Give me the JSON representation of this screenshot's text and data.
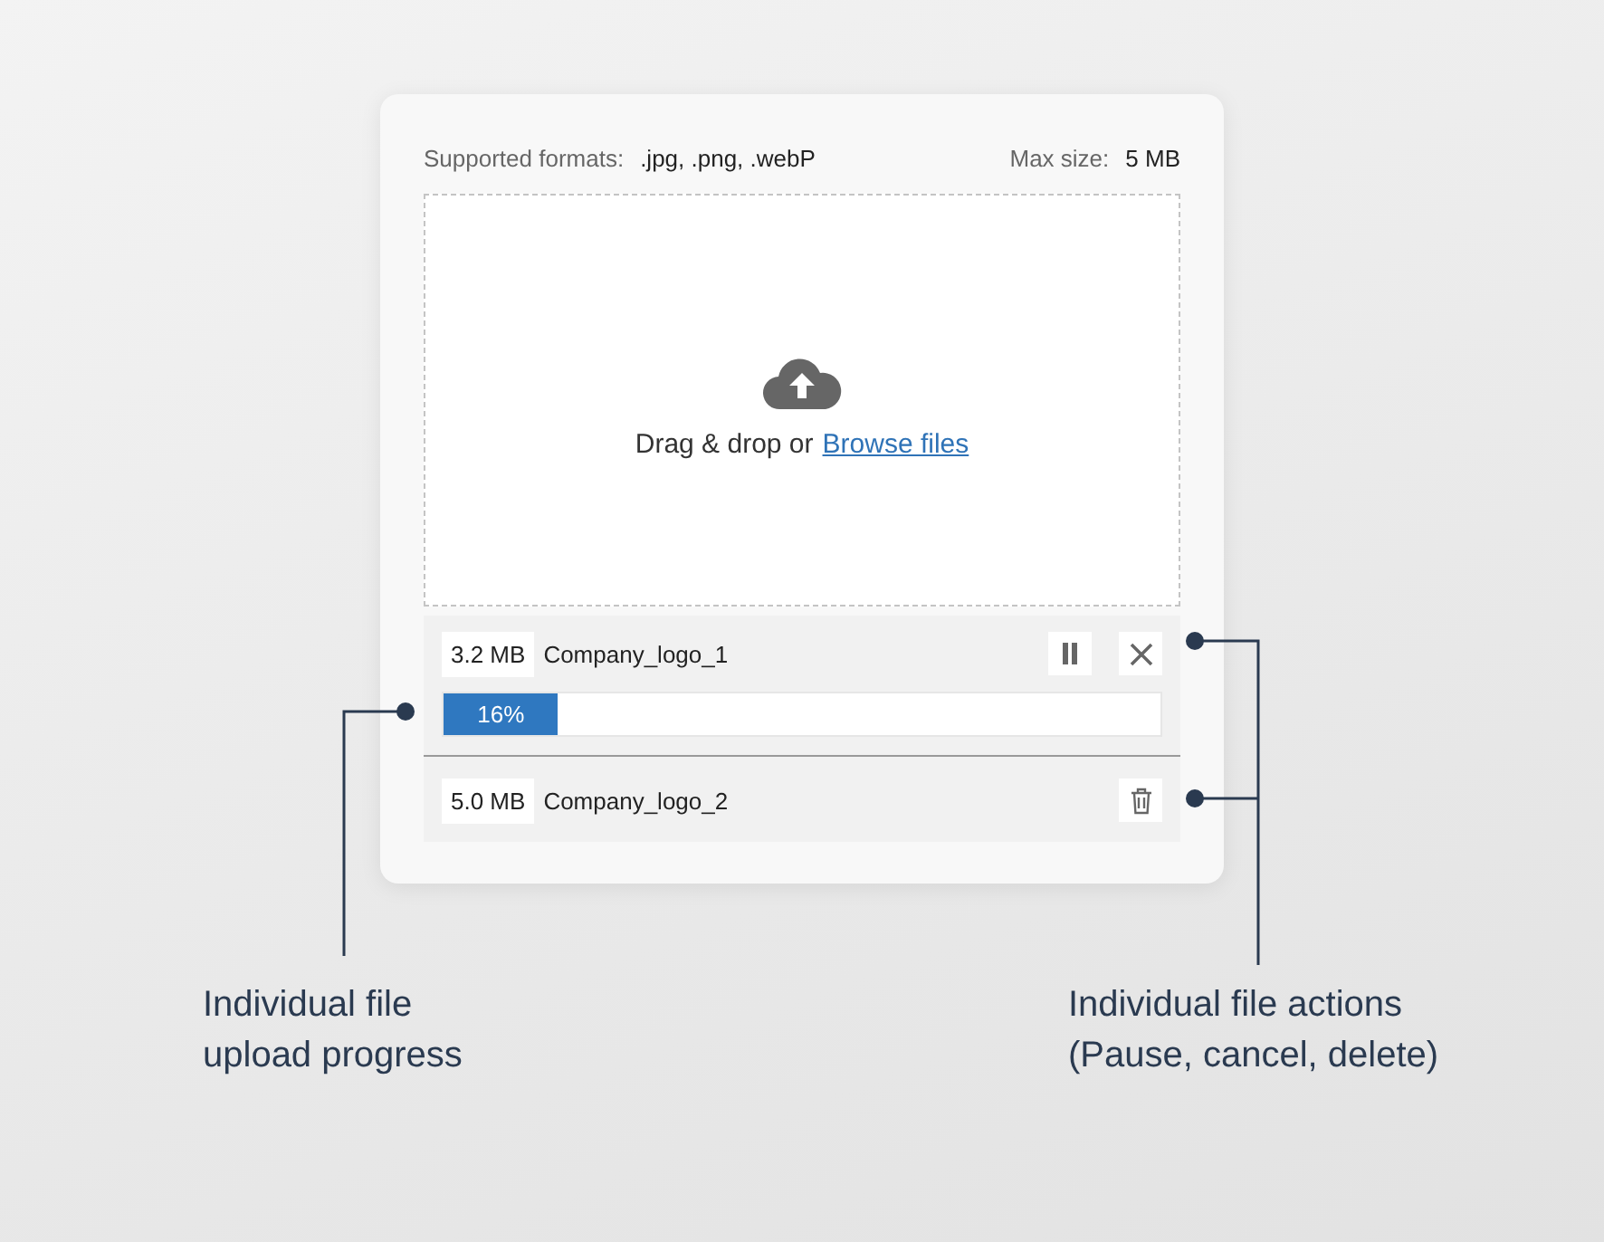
{
  "header": {
    "formats_label": "Supported formats:",
    "formats": ".jpg, .png, .webP",
    "size_label": "Max size:",
    "size": "5 MB"
  },
  "dropzone": {
    "text": "Drag & drop or",
    "link": "Browse files"
  },
  "files": [
    {
      "kind": "uploading",
      "size": "3.2 MB",
      "name": "Company_logo_1",
      "level": 0.16,
      "reading": "16%",
      "actions": [
        {
          "kind": "pause"
        },
        {
          "kind": "cancel"
        }
      ]
    },
    {
      "kind": "done",
      "size": "5.0 MB",
      "name": "Company_logo_2",
      "actions": [
        {
          "kind": "delete"
        }
      ]
    }
  ],
  "annotations": [
    {
      "kind": "left",
      "text": "Individual file\nupload progress"
    },
    {
      "kind": "right",
      "text": "Individual file actions\n(Pause, cancel, delete)"
    }
  ]
}
